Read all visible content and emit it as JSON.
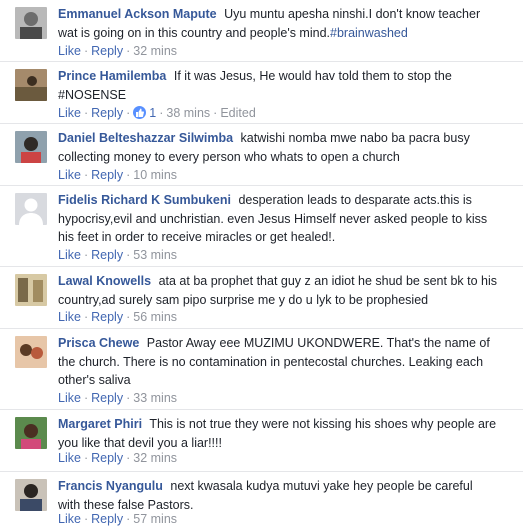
{
  "actions": {
    "like": "Like",
    "reply": "Reply",
    "separator": "·"
  },
  "comments": [
    {
      "author": "Emmanuel Ackson Mapute",
      "text": "Uyu muntu apesha ninshi.I don't know teacher wat is going on in this country and people's mind.",
      "hashtag": "#brainwashed",
      "time": "32 mins"
    },
    {
      "author": "Prince Hamilemba",
      "text": "If it was Jesus, He would hav told them to stop the #NOSENSE",
      "reactions": "1",
      "time": "38 mins",
      "edited": "Edited"
    },
    {
      "author": "Daniel Belteshazzar Silwimba",
      "text": "katwishi nomba mwe nabo ba pacra busy collecting money to every person who whats to open a church",
      "time": "10 mins"
    },
    {
      "author": "Fidelis Richard K Sumbukeni",
      "text": "desperation leads to desparate acts.this is hypocrisy,evil and unchristian. even Jesus Himself never asked people to kiss his feet in order to receive miracles or get healed!.",
      "time": "53 mins"
    },
    {
      "author": "Lawal Knowells",
      "text": "ata at ba prophet that guy z an idiot he shud be sent bk to his country,ad surely sam pipo surprise me y do u lyk to be prophesied",
      "time": "56 mins"
    },
    {
      "author": "Prisca Chewe",
      "text": "Pastor Away eee MUZIMU UKONDWERE. That's the name of the church. There is no contamination in pentecostal churches. Leaking each other's saliva",
      "time": "33 mins"
    },
    {
      "author": "Margaret Phiri",
      "text": "This is not true they were not kissing his shoes why people are you like that devil you a liar!!!!",
      "time": "32 mins"
    },
    {
      "author": "Francis Nyangulu",
      "text": "next kwasala kudya mutuvi yake hey people be careful with these false Pastors.",
      "time": "57 mins"
    }
  ]
}
